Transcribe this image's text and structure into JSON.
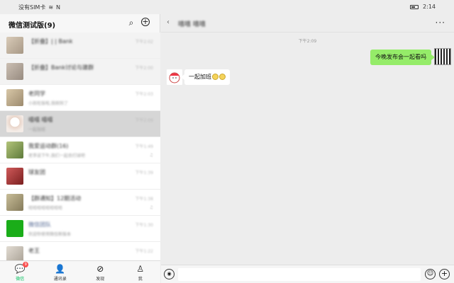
{
  "status_bar": {
    "carrier": "没有SIM卡",
    "time": "2:14"
  },
  "left": {
    "title": "微信测试版(9)",
    "chats": [
      {
        "name": "【折叠】| | Bank",
        "preview": "",
        "time": "下午2:02",
        "extra": "",
        "avatar_color": "#c9b8a8"
      },
      {
        "name": "【折叠】Bank讨论与建群",
        "preview": "",
        "time": "下午2:00",
        "extra": "",
        "avatar_color": "#b9aea5"
      },
      {
        "name": "老同学",
        "preview": "小凯吃饭啦,我刚到了",
        "time": "下午2:03",
        "extra": "",
        "avatar_color": "#c6b091"
      },
      {
        "name": "嘻嘻 嘻嘻",
        "preview": "一起加班",
        "time": "下午2:09",
        "extra": "",
        "avatar_color": "#f1e6e0"
      },
      {
        "name": "我爱运动群(16)",
        "preview": "老李说下午,我们一起去打球吧",
        "time": "下午1:49",
        "extra": "",
        "avatar_color": "#8da35a"
      },
      {
        "name": "球友团",
        "preview": "",
        "time": "下午1:39",
        "extra": "",
        "avatar_color": "#b23b3b"
      },
      {
        "name": "【群通知】12期活动",
        "preview": "哈哈哈哈哈哈哈哈",
        "time": "下午1:38",
        "extra": "",
        "avatar_color": "#a89e7d"
      },
      {
        "name": "微信团队",
        "preview": "欢迎你使用微信新版本",
        "time": "下午1:30",
        "extra": "",
        "avatar_color": "#1aad19"
      },
      {
        "name": "老王",
        "preview": "",
        "time": "下午1:22",
        "extra": "",
        "avatar_color": "#cfc9c0"
      }
    ]
  },
  "nav": {
    "items": [
      {
        "label": "微信",
        "badge": "9"
      },
      {
        "label": "通讯录",
        "badge": ""
      },
      {
        "label": "发现",
        "badge": ""
      },
      {
        "label": "我",
        "badge": ""
      }
    ]
  },
  "chat": {
    "title": "嘻嘻 嘻嘻",
    "time_divider": "下午2:09",
    "outgoing": "今晚发布会一起看吗",
    "incoming": "一起加班"
  }
}
